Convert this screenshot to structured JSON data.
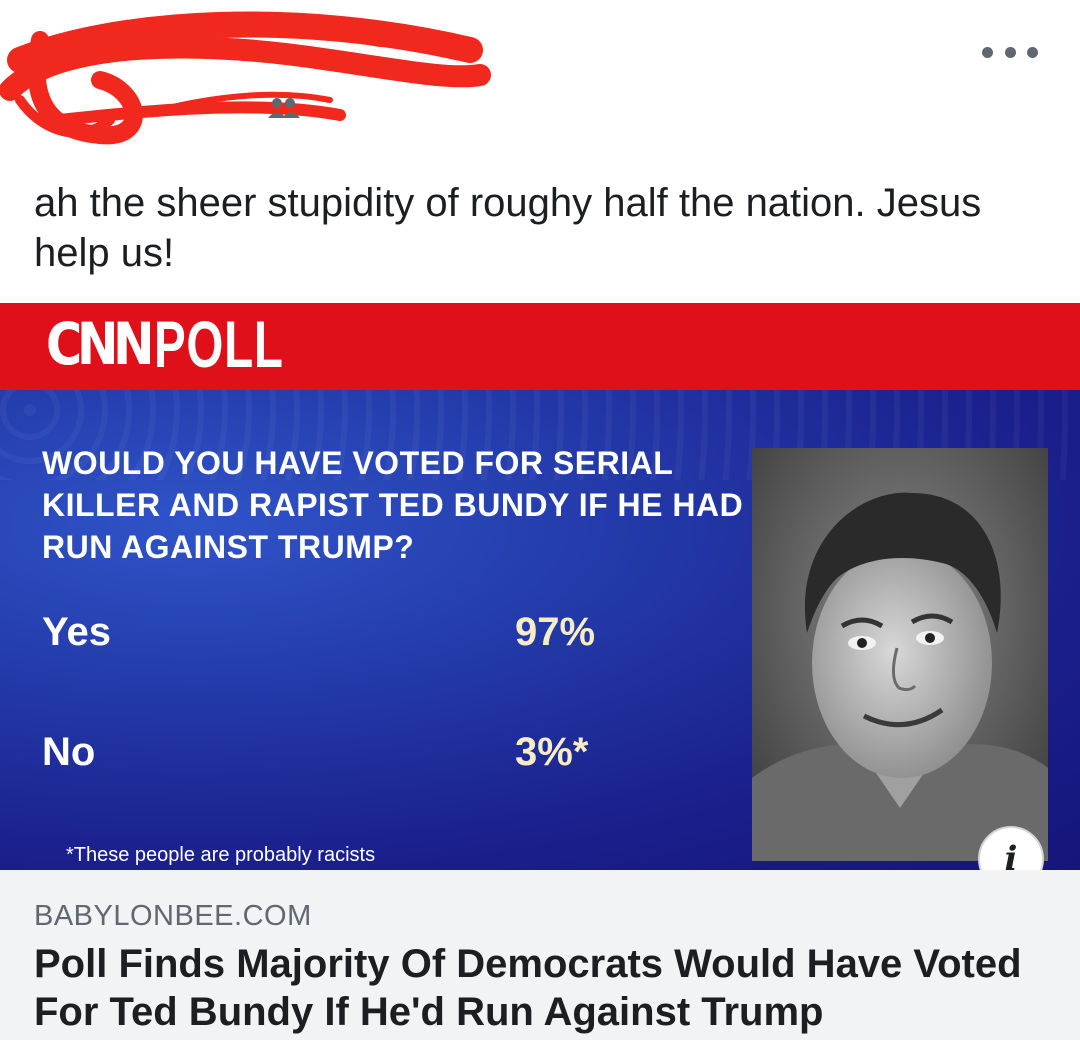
{
  "post": {
    "text": "ah the sheer stupidity of roughy half the nation.  Jesus help us!"
  },
  "header": {
    "more_icon": "ellipsis-horizontal-icon",
    "audience_icon": "friends-icon"
  },
  "shared_image": {
    "brand": "CNN",
    "banner": "POLL",
    "question": "WOULD YOU HAVE VOTED FOR SERIAL KILLER AND RAPIST TED BUNDY IF HE HAD RUN AGAINST TRUMP?",
    "answers": [
      {
        "label": "Yes",
        "percent": "97%"
      },
      {
        "label": "No",
        "percent": "3%*"
      }
    ],
    "footnote": "*These people are probably racists",
    "colors": {
      "banner_red": "#e0101a",
      "panel_blue": "#1a1f8c",
      "percent_cream": "#f7edc5"
    }
  },
  "link": {
    "domain": "BABYLONBEE.COM",
    "title": "Poll Finds Majority Of Democrats Would Have Voted For Ted Bundy If He'd Run Against Trump",
    "info_icon": "info-icon"
  }
}
